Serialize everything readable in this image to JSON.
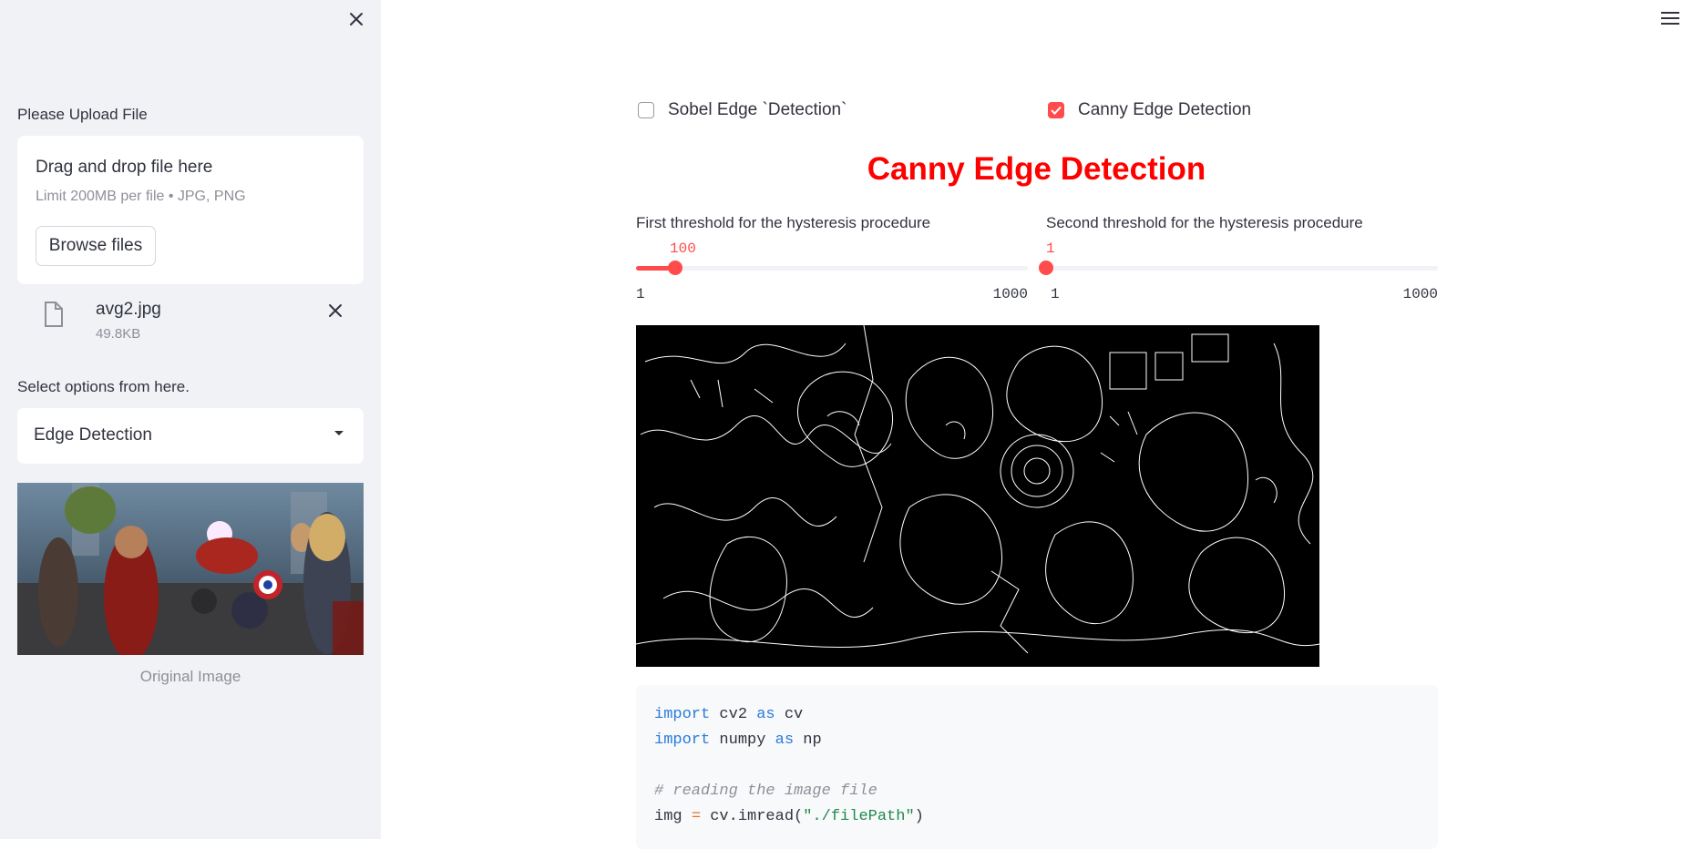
{
  "sidebar": {
    "upload_label": "Please Upload File",
    "uploader": {
      "title": "Drag and drop file here",
      "limit": "Limit 200MB per file • JPG, PNG",
      "browse_label": "Browse files"
    },
    "file": {
      "name": "avg2.jpg",
      "size": "49.8KB"
    },
    "options_label": "Select options from here.",
    "select_value": "Edge Detection",
    "image_caption": "Original Image"
  },
  "main": {
    "checkboxes": [
      {
        "label": "Sobel Edge `Detection`",
        "checked": false
      },
      {
        "label": "Canny Edge Detection",
        "checked": true
      }
    ],
    "title": "Canny Edge Detection",
    "sliders": [
      {
        "label": "First threshold for the hysteresis procedure",
        "value": "100",
        "min": "1",
        "max": "1000",
        "fraction": 0.099
      },
      {
        "label": "Second threshold for the hysteresis procedure",
        "value": "1",
        "min": "1",
        "max": "1000",
        "fraction": 0.0
      }
    ],
    "code": {
      "l1_kw1": "import",
      "l1_mod": " cv2 ",
      "l1_kw2": "as",
      "l1_alias": " cv",
      "l2_kw1": "import",
      "l2_mod": " numpy ",
      "l2_kw2": "as",
      "l2_alias": " np",
      "l4_comment": "# reading the image file",
      "l5_var": "img ",
      "l5_op": "=",
      "l5_call": " cv.imread(",
      "l5_str": "\"./filePath\"",
      "l5_end": ")"
    }
  },
  "colors": {
    "accent": "#ff4b4b",
    "title": "#ff0000",
    "sidebar_bg": "#f0f2f6"
  },
  "icons": [
    "close-icon",
    "file-icon",
    "chevron-down-icon",
    "hamburger-icon",
    "check-icon"
  ]
}
